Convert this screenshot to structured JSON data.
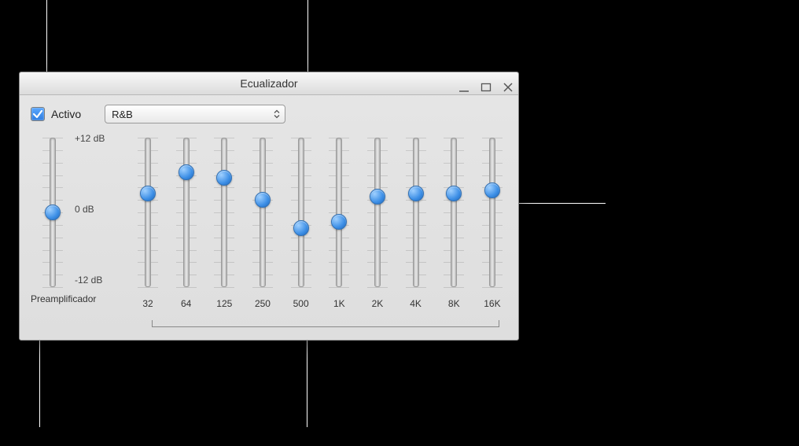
{
  "window": {
    "title": "Ecualizador"
  },
  "controls": {
    "active_label": "Activo",
    "active_checked": true,
    "preset_value": "R&B"
  },
  "scale": {
    "top": "+12 dB",
    "mid": "0 dB",
    "bottom": "-12 dB"
  },
  "preamp": {
    "caption": "Preamplificador",
    "value_db": 0
  },
  "bands": [
    {
      "freq": "32",
      "value_db": 3.0
    },
    {
      "freq": "64",
      "value_db": 6.5
    },
    {
      "freq": "125",
      "value_db": 5.5
    },
    {
      "freq": "250",
      "value_db": 2.0
    },
    {
      "freq": "500",
      "value_db": -2.5
    },
    {
      "freq": "1K",
      "value_db": -1.5
    },
    {
      "freq": "2K",
      "value_db": 2.5
    },
    {
      "freq": "4K",
      "value_db": 3.0
    },
    {
      "freq": "8K",
      "value_db": 3.0
    },
    {
      "freq": "16K",
      "value_db": 3.5
    }
  ],
  "colors": {
    "thumb": "#3d8fe6",
    "window_bg": "#e0e0e0"
  }
}
